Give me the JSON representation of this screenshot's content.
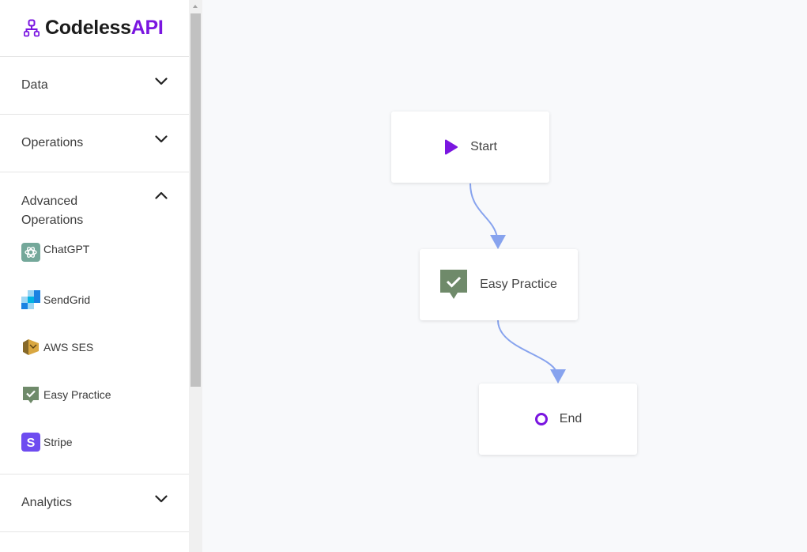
{
  "brand": {
    "name_dark": "Codeless",
    "name_accent": "API",
    "accent_color": "#7a16e0"
  },
  "sidebar": {
    "sections": [
      {
        "label": "Data",
        "expanded": false,
        "icon": "chevron-down-icon"
      },
      {
        "label": "Operations",
        "expanded": false,
        "icon": "chevron-down-icon"
      },
      {
        "label": "Advanced Operations",
        "expanded": true,
        "icon": "chevron-up-icon",
        "items": [
          {
            "label": "ChatGPT",
            "icon": "chatgpt-icon"
          },
          {
            "label": "SendGrid",
            "icon": "sendgrid-icon"
          },
          {
            "label": "AWS SES",
            "icon": "aws-ses-icon"
          },
          {
            "label": "Easy Practice",
            "icon": "easy-practice-icon"
          },
          {
            "label": "Stripe",
            "icon": "stripe-icon"
          }
        ]
      },
      {
        "label": "Analytics",
        "expanded": false,
        "icon": "chevron-down-icon"
      }
    ]
  },
  "flow": {
    "edge_color": "#87a3ee",
    "nodes": [
      {
        "label": "Start",
        "icon": "play-icon"
      },
      {
        "label": "Easy Practice",
        "icon": "easy-practice-icon"
      },
      {
        "label": "End",
        "icon": "end-circle-icon"
      }
    ]
  }
}
